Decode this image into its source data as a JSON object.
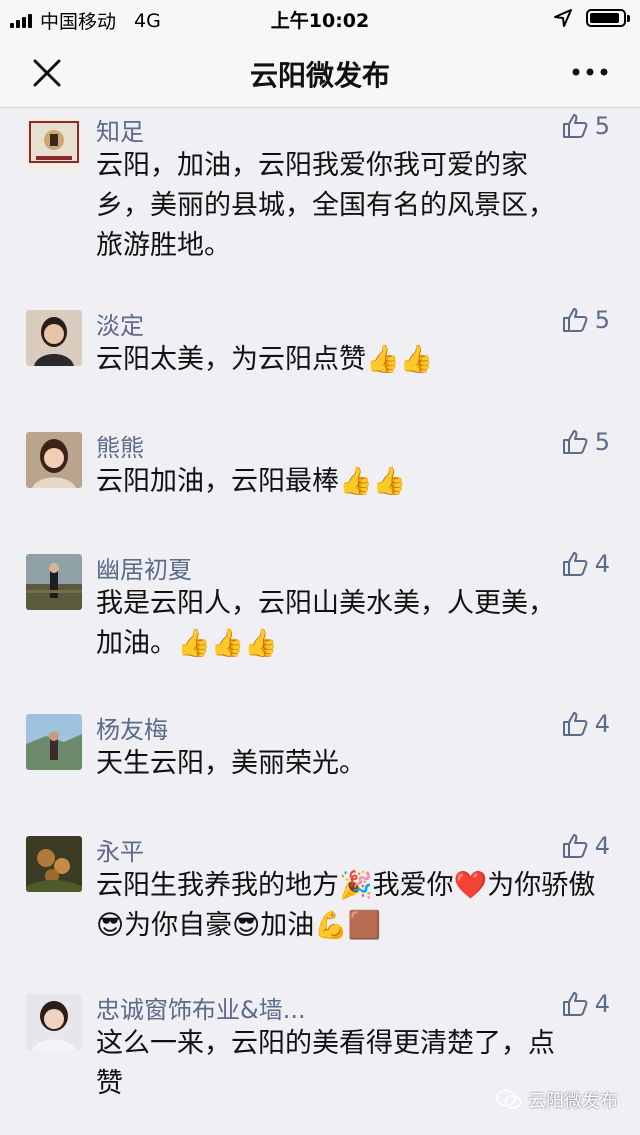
{
  "status_bar": {
    "carrier": "中国移动",
    "network": "4G",
    "time": "上午10:02"
  },
  "nav": {
    "title": "云阳微发布",
    "close_icon": "close-icon",
    "more_icon": "more-icon"
  },
  "comments": [
    {
      "name": "知足",
      "likes": "5",
      "text": "云阳，加油，云阳我爱你我可爱的家乡，美丽的县城，全国有名的风景区，旅游胜地。"
    },
    {
      "name": "淡定",
      "likes": "5",
      "text": "云阳太美，为云阳点赞👍👍"
    },
    {
      "name": "熊熊",
      "likes": "5",
      "text": "云阳加油，云阳最棒👍👍"
    },
    {
      "name": "幽居初夏",
      "likes": "4",
      "text": "我是云阳人，云阳山美水美，人更美，加油。👍👍👍"
    },
    {
      "name": "杨友梅",
      "likes": "4",
      "text": "天生云阳，美丽荣光。"
    },
    {
      "name": "永平",
      "likes": "4",
      "text": "云阳生我养我的地方🎉我爱你❤️为你骄傲😎为你自豪😎加油💪🟫"
    },
    {
      "name": "忠诚窗饰布业&墙...",
      "likes": "4",
      "text": "这么一来，云阳的美看得更清楚了，点赞"
    }
  ],
  "watermark": {
    "text": "云阳微发布",
    "icon": "wechat-icon"
  },
  "colors": {
    "name": "#5b6b8a",
    "background": "#efeff4",
    "bar": "#f7f7f7"
  }
}
